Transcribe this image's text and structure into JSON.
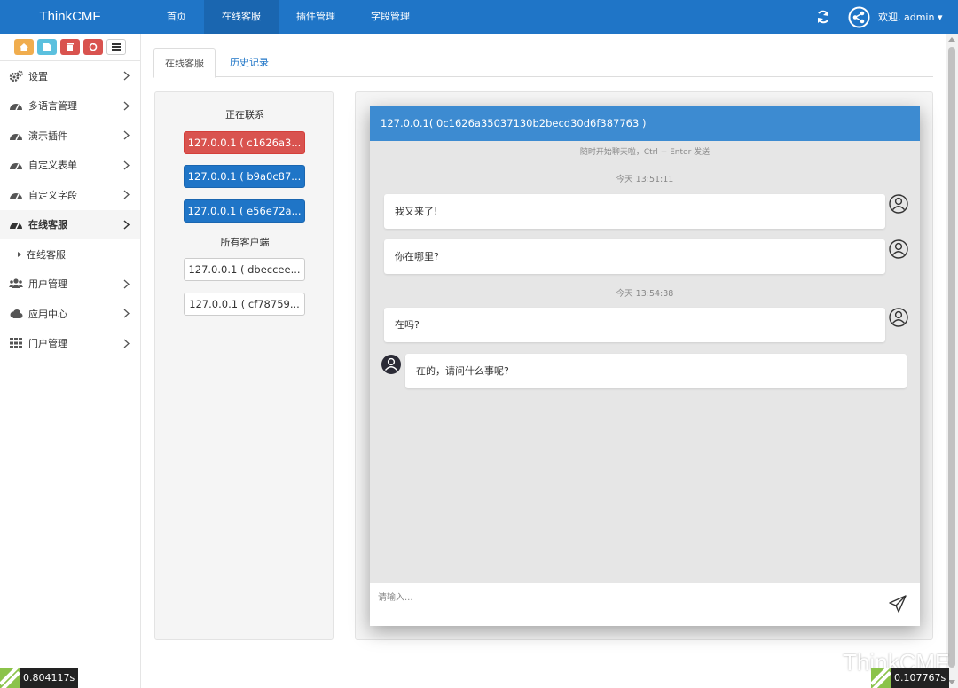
{
  "topbar": {
    "brand": "ThinkCMF",
    "nav": [
      {
        "label": "首页"
      },
      {
        "label": "在线客服"
      },
      {
        "label": "插件管理"
      },
      {
        "label": "字段管理"
      }
    ],
    "welcome": "欢迎, admin"
  },
  "sidebar": {
    "items": [
      {
        "label": "设置"
      },
      {
        "label": "多语言管理"
      },
      {
        "label": "演示插件"
      },
      {
        "label": "自定义表单"
      },
      {
        "label": "自定义字段"
      },
      {
        "label": "在线客服"
      }
    ],
    "sub": "在线客服",
    "items2": [
      {
        "label": "用户管理"
      },
      {
        "label": "应用中心"
      },
      {
        "label": "门户管理"
      }
    ]
  },
  "tabs": {
    "active": "在线客服",
    "history": "历史记录"
  },
  "contacts": {
    "active_header": "正在联系",
    "active": [
      "127.0.0.1 ( c1626a3...",
      "127.0.0.1 ( b9a0c87...",
      "127.0.0.1 ( e56e72a..."
    ],
    "all_header": "所有客户端",
    "all": [
      "127.0.0.1 ( dbeccee...",
      "127.0.0.1 ( cf78759..."
    ]
  },
  "chat": {
    "title": "127.0.0.1( 0c1626a35037130b2becd30d6f387763 )",
    "hint": "随时开始聊天啦，Ctrl + Enter 发送",
    "time1": "今天 13:51:11",
    "time2": "今天 13:54:38",
    "messages": [
      "我又来了!",
      "你在哪里?",
      "在吗?",
      "在的，请问什么事呢?"
    ],
    "input_placeholder": "请输入..."
  },
  "timers": {
    "left": "0.804117s",
    "right": "0.107767s"
  },
  "watermark": "ThinkCMF",
  "colors": {
    "primary": "#1f75c7",
    "danger": "#d9534f",
    "chat_header": "#3d8bd1"
  }
}
